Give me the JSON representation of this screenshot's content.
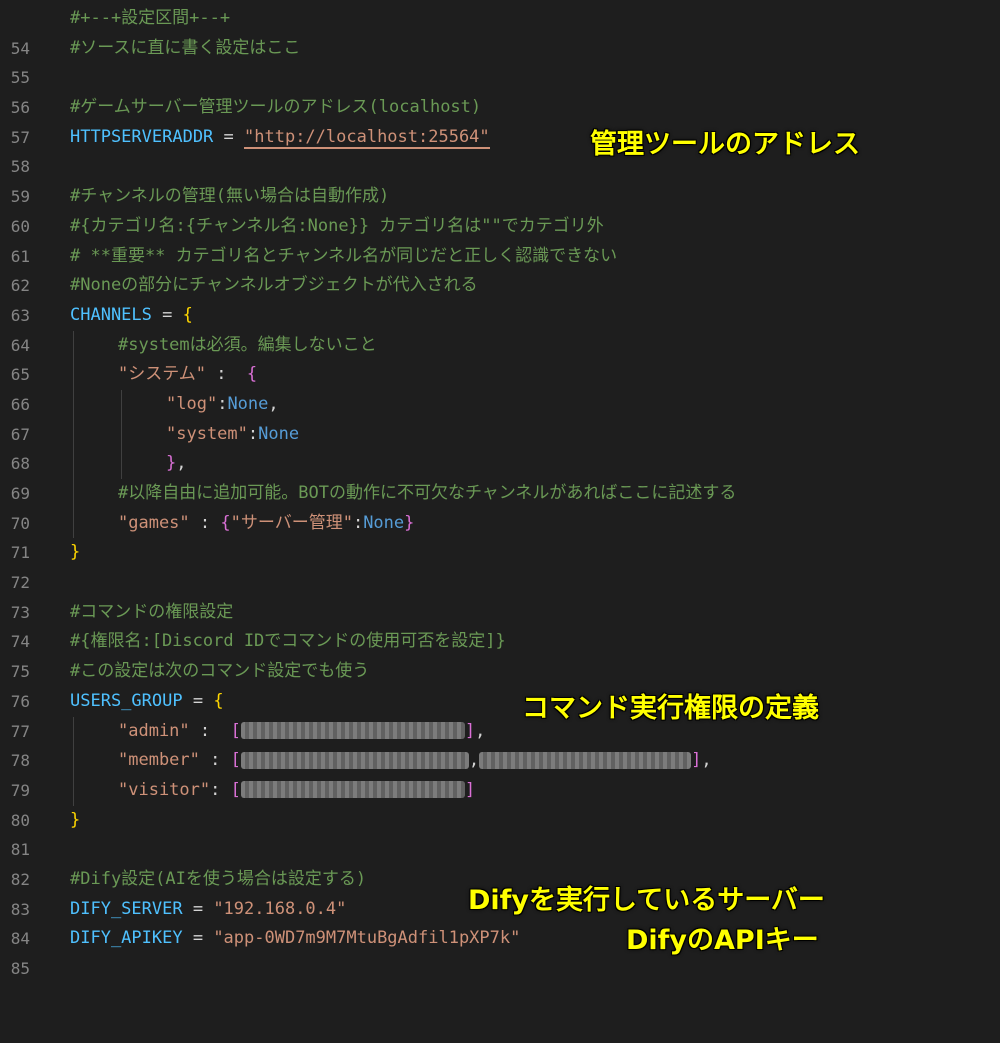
{
  "editor": {
    "line_numbers": [
      "54",
      "55",
      "56",
      "57",
      "58",
      "59",
      "60",
      "61",
      "62",
      "63",
      "64",
      "65",
      "66",
      "67",
      "68",
      "69",
      "70",
      "71",
      "72",
      "73",
      "74",
      "75",
      "76",
      "77",
      "78",
      "79",
      "80",
      "81",
      "82",
      "83",
      "84",
      "85"
    ],
    "comments": {
      "c54": "#+--+設定区間+--+",
      "c55": "#ソースに直に書く設定はここ",
      "c57": "#ゲームサーバー管理ツールのアドレス(localhost)",
      "c60": "#チャンネルの管理(無い場合は自動作成)",
      "c61": "#{カテゴリ名:{チャンネル名:None}} カテゴリ名は\"\"でカテゴリ外",
      "c62": "# **重要** カテゴリ名とチャンネル名が同じだと正しく認識できない",
      "c63": "#Noneの部分にチャンネルオブジェクトが代入される",
      "c65": "#systemは必須。編集しないこと",
      "c70": "#以降自由に追加可能。BOTの動作に不可欠なチャンネルがあればここに記述する",
      "c74": "#コマンドの権限設定",
      "c75": "#{権限名:[Discord IDでコマンドの使用可否を設定]}",
      "c76": "#この設定は次のコマンド設定でも使う",
      "c83": "#Dify設定(AIを使う場合は設定する)"
    },
    "vars": {
      "httpserveraddr": "HTTPSERVERADDR",
      "channels": "CHANNELS",
      "users_group": "USERS_GROUP",
      "dify_server": "DIFY_SERVER",
      "dify_apikey": "DIFY_APIKEY"
    },
    "strings": {
      "url": "\"http://localhost:25564\"",
      "system_jp": "\"システム\"",
      "log": "\"log\"",
      "system": "\"system\"",
      "games": "\"games\"",
      "server_mgmt": "\"サーバー管理\"",
      "admin": "\"admin\"",
      "member": "\"member\"",
      "visitor": "\"visitor\"",
      "dify_server_val": "\"192.168.0.4\"",
      "dify_apikey_val": "\"app-0WD7m9M7MtuBgAdfil1pXP7k\""
    },
    "keywords": {
      "none": "None"
    }
  },
  "annotations": {
    "admin_tool_address": "管理ツールのアドレス",
    "command_permission": "コマンド実行権限の定義",
    "dify_server": "Difyを実行しているサーバー",
    "dify_apikey": "DifyのAPIキー"
  },
  "colors": {
    "background": "#1e1e1e",
    "comment": "#6a9955",
    "variable": "#4fc1ff",
    "string": "#ce9178",
    "keyword": "#569cd6",
    "bracket_level1": "#ffd700",
    "bracket_level2": "#da70d6",
    "bracket_level3": "#179fff",
    "annotation": "#ffff00"
  }
}
